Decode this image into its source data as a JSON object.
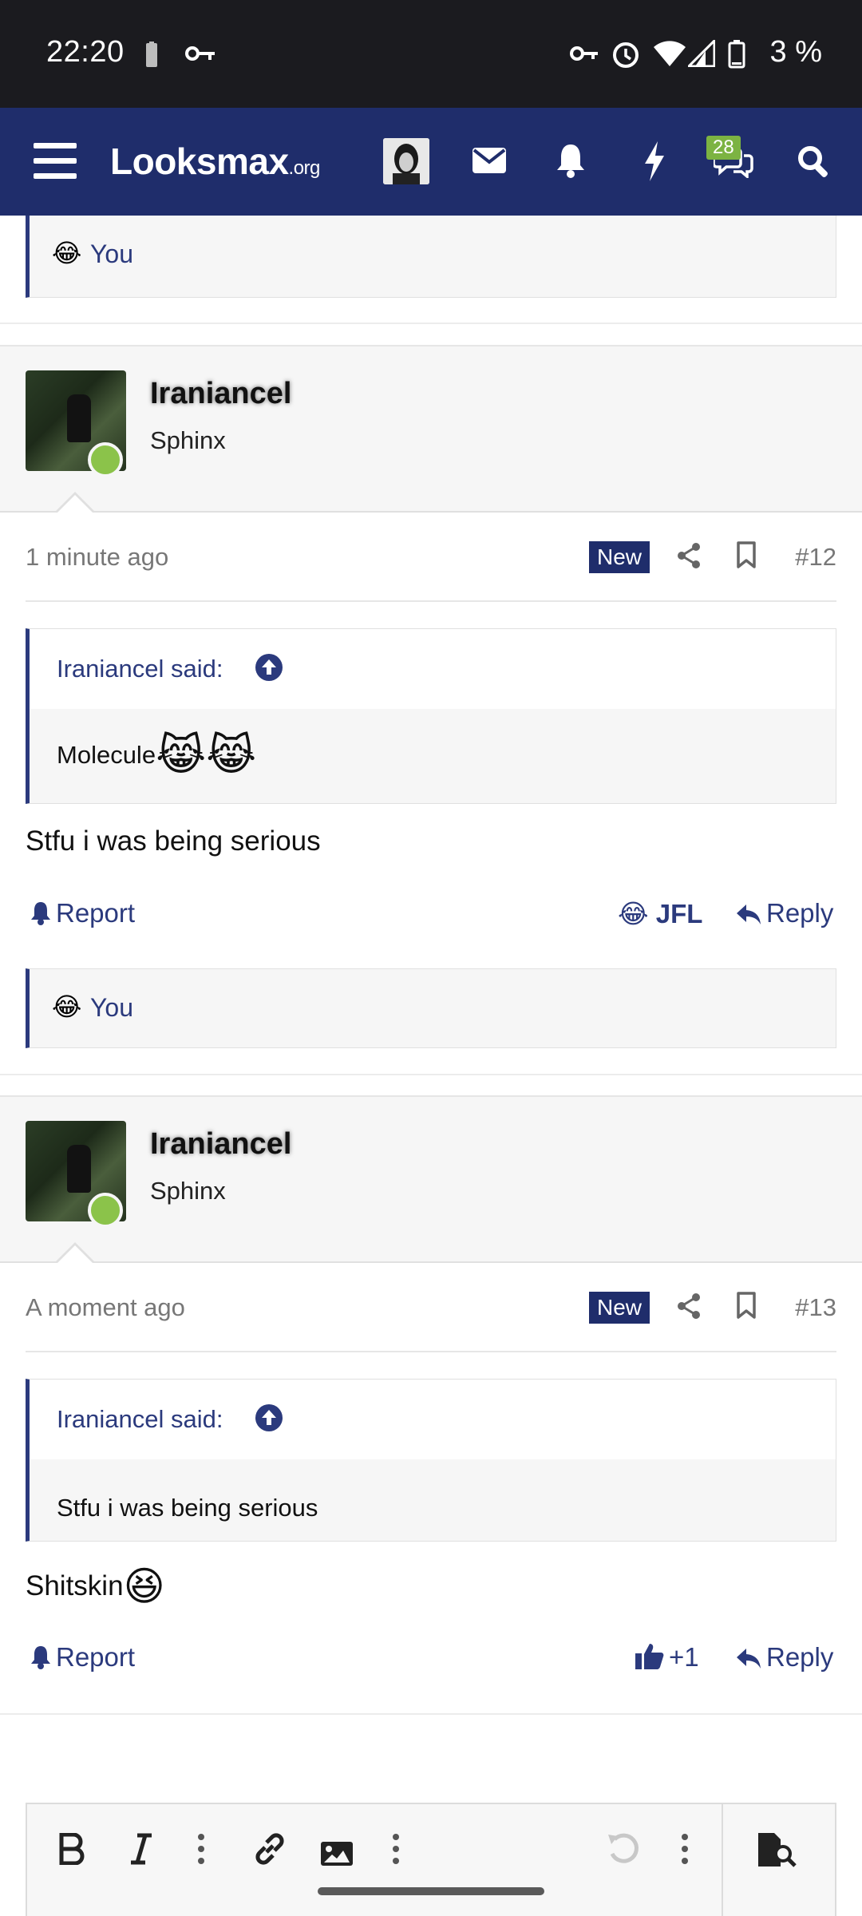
{
  "status_bar": {
    "time": "22:20",
    "battery_percent": "3 %",
    "icons": [
      "battery-icon",
      "vpn-key-icon",
      "key-icon",
      "alarm-icon",
      "wifi-icon",
      "signal-icon",
      "battery-icon"
    ]
  },
  "nav": {
    "logo_main": "Looksmax",
    "logo_suffix": ".org",
    "conversations_badge": "28",
    "icons": [
      "menu-icon",
      "avatar",
      "mail-icon",
      "bell-icon",
      "lightning-icon",
      "chat-icon",
      "search-icon"
    ]
  },
  "colors": {
    "brand": "#1f2d6b",
    "link": "#2b3a7d",
    "online": "#8bc34a"
  },
  "top_reaction": {
    "emoji": "😂",
    "text": "You"
  },
  "posts": [
    {
      "username": "Iraniancel",
      "user_title": "Sphinx",
      "time": "1 minute ago",
      "new_label": "New",
      "post_number": "#12",
      "quote_author": "Iraniancel said:",
      "quote_text": "Molecule",
      "quote_emoji": "😹😹",
      "body_text": "Stfu i was being serious",
      "body_emoji": "",
      "report_label": "Report",
      "reaction_emoji": "😂",
      "reaction_label": "JFL",
      "reply_label": "Reply",
      "reacted_by": "You"
    },
    {
      "username": "Iraniancel",
      "user_title": "Sphinx",
      "time": "A moment ago",
      "new_label": "New",
      "post_number": "#13",
      "quote_author": "Iraniancel said:",
      "quote_text": "Stfu i was being serious",
      "quote_emoji": "",
      "body_text": "Shitskin",
      "body_emoji": "😆",
      "report_label": "Report",
      "reaction_emoji": "",
      "reaction_label": "+1",
      "reply_label": "Reply"
    }
  ],
  "editor": {
    "tools": [
      "bold-icon",
      "italic-icon",
      "more-icon",
      "link-icon",
      "image-icon",
      "more-icon",
      "undo-icon",
      "more-icon",
      "preview-icon"
    ]
  }
}
